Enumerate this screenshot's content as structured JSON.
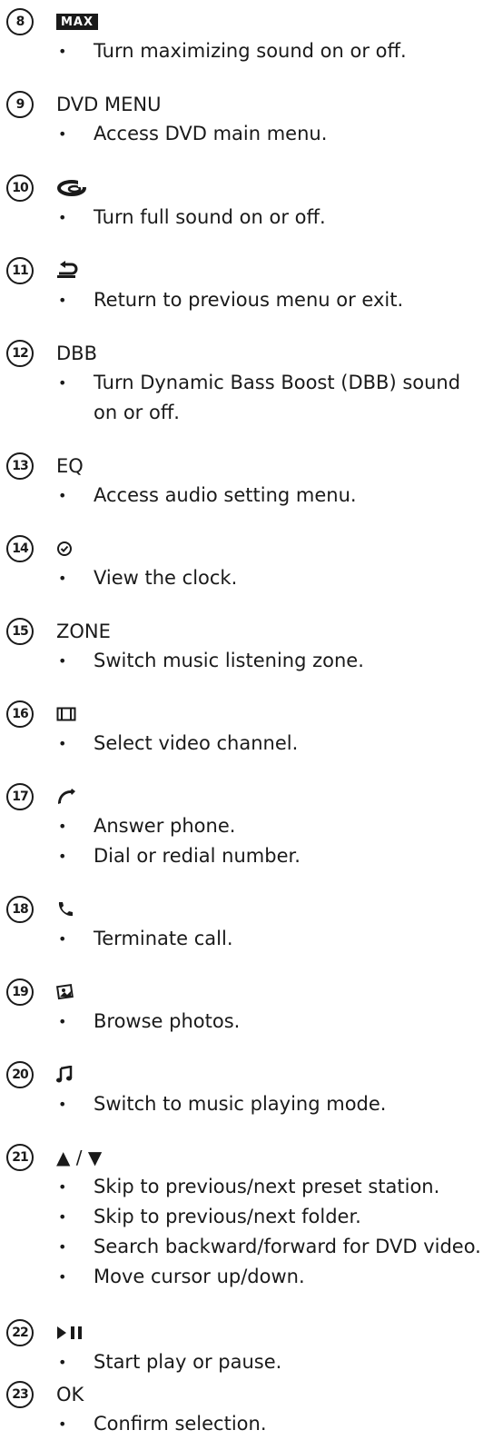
{
  "items": [
    {
      "number": "8",
      "icon": "max-icon",
      "badge_text": "MAX",
      "bullets": [
        "Turn maximizing sound on or off."
      ]
    },
    {
      "number": "9",
      "label": "DVD MENU",
      "bullets": [
        "Access DVD main menu."
      ]
    },
    {
      "number": "10",
      "icon": "full-sound-icon",
      "bullets": [
        "Turn full sound on or off."
      ]
    },
    {
      "number": "11",
      "icon": "back-icon",
      "bullets": [
        "Return to previous menu or exit."
      ]
    },
    {
      "number": "12",
      "label": "DBB",
      "bullets": [
        "Turn Dynamic Bass Boost (DBB) sound on or off."
      ]
    },
    {
      "number": "13",
      "label": "EQ",
      "bullets": [
        "Access audio setting menu."
      ]
    },
    {
      "number": "14",
      "icon": "clock-icon",
      "bullets": [
        "View the clock."
      ]
    },
    {
      "number": "15",
      "label": "ZONE",
      "bullets": [
        "Switch music listening zone."
      ]
    },
    {
      "number": "16",
      "icon": "video-icon",
      "bullets": [
        "Select video channel."
      ]
    },
    {
      "number": "17",
      "icon": "phone-answer-icon",
      "bullets": [
        "Answer phone.",
        "Dial or redial number."
      ]
    },
    {
      "number": "18",
      "icon": "phone-end-icon",
      "bullets": [
        "Terminate call."
      ]
    },
    {
      "number": "19",
      "icon": "photo-icon",
      "bullets": [
        "Browse photos."
      ]
    },
    {
      "number": "20",
      "icon": "music-note-icon",
      "bullets": [
        "Switch to music playing mode."
      ]
    },
    {
      "number": "21",
      "label": "▲ / ▼",
      "bullets": [
        "Skip to previous/next preset station.",
        "Skip to previous/next folder.",
        "Search backward/forward for DVD video.",
        "Move cursor up/down."
      ]
    },
    {
      "number": "22",
      "icon": "play-pause-icon",
      "bullets": [
        "Start play or pause."
      ]
    },
    {
      "number": "23",
      "label": "OK",
      "bullets": [
        "Confirm selection."
      ]
    }
  ]
}
